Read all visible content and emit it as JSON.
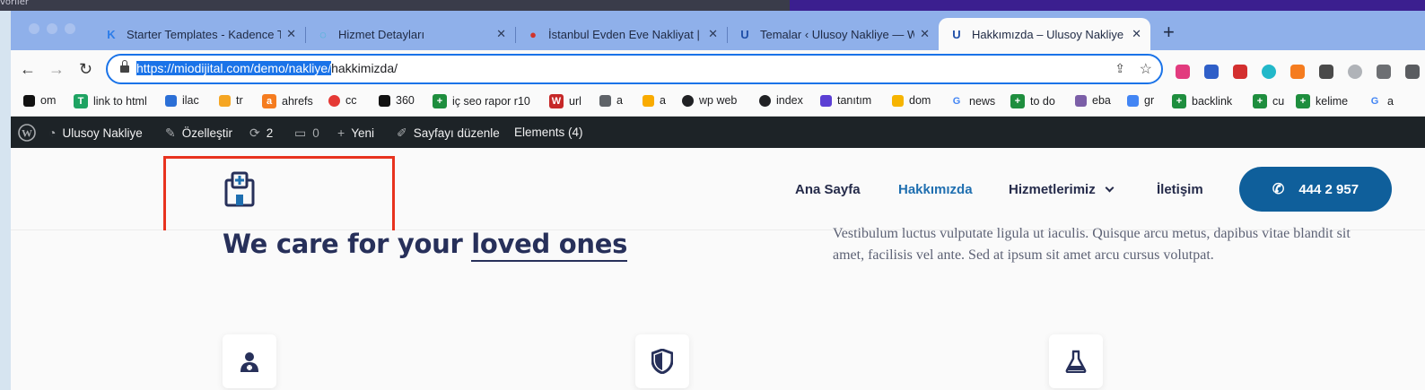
{
  "desktop": {
    "corner_text": "voriler"
  },
  "browser": {
    "tabs": [
      {
        "title": "Starter Templates - Kadence T",
        "icon": "kadence-icon",
        "color": "#2b7de9"
      },
      {
        "title": "Hizmet Detayları",
        "icon": "loading-spinner-icon",
        "color": "#22b8c9"
      },
      {
        "title": "İstanbul Evden Eve Nakliyat | S",
        "icon": "truck-logo-icon",
        "color": "#d0342c"
      },
      {
        "title": "Temalar ‹ Ulusoy Nakliye — Wo",
        "icon": "u-logo-icon",
        "color": "#1f4fa8"
      },
      {
        "title": "Hakkımızda – Ulusoy Nakliye",
        "icon": "u-logo-icon",
        "color": "#1f4fa8",
        "active": true
      }
    ],
    "close_glyph": "✕",
    "new_tab_glyph": "+",
    "url_selected": "https://miodijital.com/demo/nakliye/",
    "url_rest": "hakkimizda/",
    "bookmarks": [
      {
        "label": "om",
        "icon": "crown-icon",
        "color": "#111111"
      },
      {
        "label": "link to html",
        "icon": "t-icon",
        "glyph": "T",
        "color": "#1ea362"
      },
      {
        "label": "ilac",
        "icon": "network-icon",
        "color": "#2b6fd6"
      },
      {
        "label": "tr",
        "icon": "yoast-icon",
        "color": "#f5a623"
      },
      {
        "label": "ahrefs",
        "icon": "ahrefs-icon",
        "glyph": "a",
        "color": "#f57c1f"
      },
      {
        "label": "cc",
        "icon": "ring-icon",
        "color": "#e53935"
      },
      {
        "label": "360",
        "icon": "triangle-icon",
        "color": "#111111"
      },
      {
        "label": "iç seo rapor r10",
        "icon": "sheets-icon",
        "glyph": "+",
        "color": "#1e8e3e"
      },
      {
        "label": "url",
        "icon": "w-circle-icon",
        "glyph": "W",
        "color": "#c62828"
      },
      {
        "label": "a",
        "icon": "figure-icon",
        "color": "#5f6368"
      },
      {
        "label": "a",
        "icon": "analytics-icon",
        "color": "#f9ab00"
      },
      {
        "label": "wp web",
        "icon": "globe-icon",
        "color": "#202124"
      },
      {
        "label": "index",
        "icon": "globe-icon",
        "color": "#202124"
      },
      {
        "label": "tanıtım",
        "icon": "list-icon",
        "color": "#5b3fd4"
      },
      {
        "label": "dom",
        "icon": "pen-icon",
        "color": "#f6b400"
      },
      {
        "label": "news",
        "icon": "google-icon",
        "glyph": "G",
        "color": "#4285f4"
      },
      {
        "label": "to do",
        "icon": "sheets-icon",
        "glyph": "+",
        "color": "#1e8e3e"
      },
      {
        "label": "eba",
        "icon": "envato-icon",
        "color": "#7b5ea7"
      },
      {
        "label": "gr",
        "icon": "people-icon",
        "color": "#4285f4"
      },
      {
        "label": "backlink",
        "icon": "sheets-icon",
        "glyph": "+",
        "color": "#1e8e3e"
      },
      {
        "label": "cu",
        "icon": "sheets-icon",
        "glyph": "+",
        "color": "#1e8e3e"
      },
      {
        "label": "kelime",
        "icon": "sheets-icon",
        "glyph": "+",
        "color": "#1e8e3e"
      },
      {
        "label": "a",
        "icon": "google-icon",
        "glyph": "G",
        "color": "#4285f4"
      }
    ]
  },
  "wp_admin_bar": {
    "site_name": "Ulusoy Nakliye",
    "customize": "Özelleştir",
    "updates_count": "2",
    "comments_count": "0",
    "new_label": "Yeni",
    "edit_page": "Sayfayı düzenle",
    "elements": "Elements (4)"
  },
  "site": {
    "nav": {
      "home": "Ana Sayfa",
      "about": "Hakkımızda",
      "services": "Hizmetlerimiz",
      "contact": "İletişim"
    },
    "phone": "444 2 957",
    "heading_plain": "We care for your ",
    "heading_underlined": "loved ones",
    "paragraph": "Vestibulum luctus vulputate ligula ut iaculis. Quisque arcu metus, dapibus vitae blandit sit amet, facilisis vel ante. Sed at ipsum sit amet arcu cursus volutpat.",
    "accent_color": "#0f5f9b",
    "heading_color": "#27305a",
    "highlight_color": "#e8321e"
  }
}
